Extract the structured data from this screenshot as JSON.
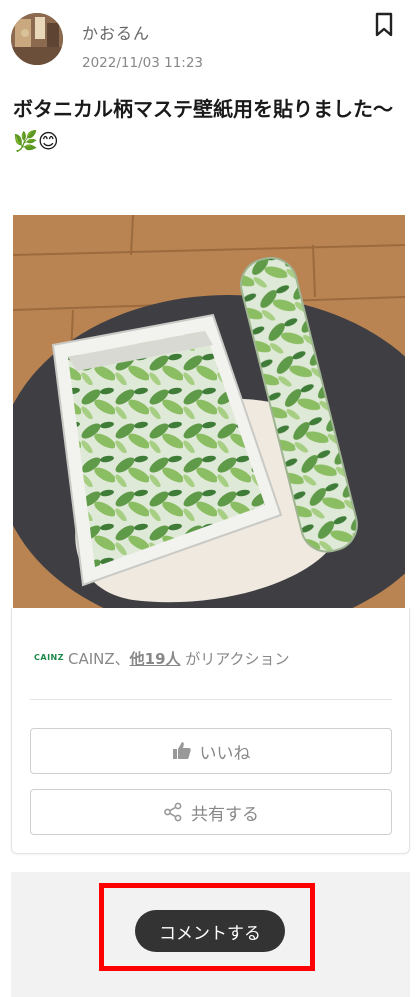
{
  "post": {
    "author": "かおるん",
    "date": "2022/11/03 11:23",
    "title": "ボタニカル柄マステ壁紙用を貼りました〜🌿😊"
  },
  "reactions": {
    "brand_logo_text": "CAINZ",
    "lead": "CAINZ、",
    "others_link": "他19人",
    "suffix": " がリアクション"
  },
  "actions": {
    "like_label": "いいね",
    "share_label": "共有する",
    "comment_label": "コメントする"
  },
  "icons": {
    "bookmark": "bookmark-icon",
    "like": "thumbs-up-icon",
    "share": "share-icon"
  }
}
